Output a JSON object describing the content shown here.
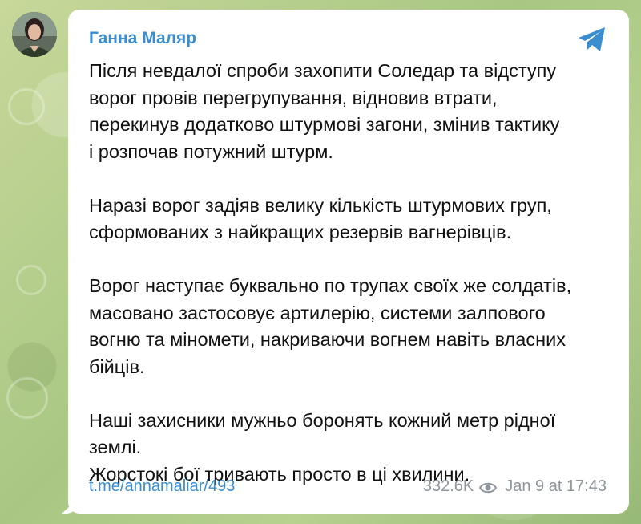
{
  "message": {
    "sender": "Ганна Маляр",
    "paragraphs": [
      [
        "Після невдалої спроби захопити Соледар та відступу",
        "ворог провів перегрупування, відновив втрати,",
        "перекинув додатково штурмові загони, змінив тактику",
        "і розпочав потужний штурм."
      ],
      [
        "Наразі ворог задіяв велику кількість штурмових груп,",
        "сформованих з найкращих резервів вагнерівців."
      ],
      [
        "Ворог наступає буквально по трупах своїх же солдатів,",
        "масовано застосовує артилерію, системи залпового",
        "вогню та міномети, накриваючи вогнем навіть власних",
        "бійців."
      ],
      [
        "Наші захисники мужньо боронять кожний метр рідної",
        "землі.",
        "Жорстокі бої тривають просто в ці хвилини."
      ]
    ],
    "link": "t.me/annamaliar/493",
    "views": "332.6K",
    "date": "Jan 9 at 17:43"
  },
  "icons": {
    "share": "telegram-paper-plane-icon",
    "views": "eye-icon"
  },
  "colors": {
    "sender": "#3a8ed0",
    "link": "#3a8ed0",
    "meta": "#8e969c",
    "bubble": "#ffffff"
  }
}
